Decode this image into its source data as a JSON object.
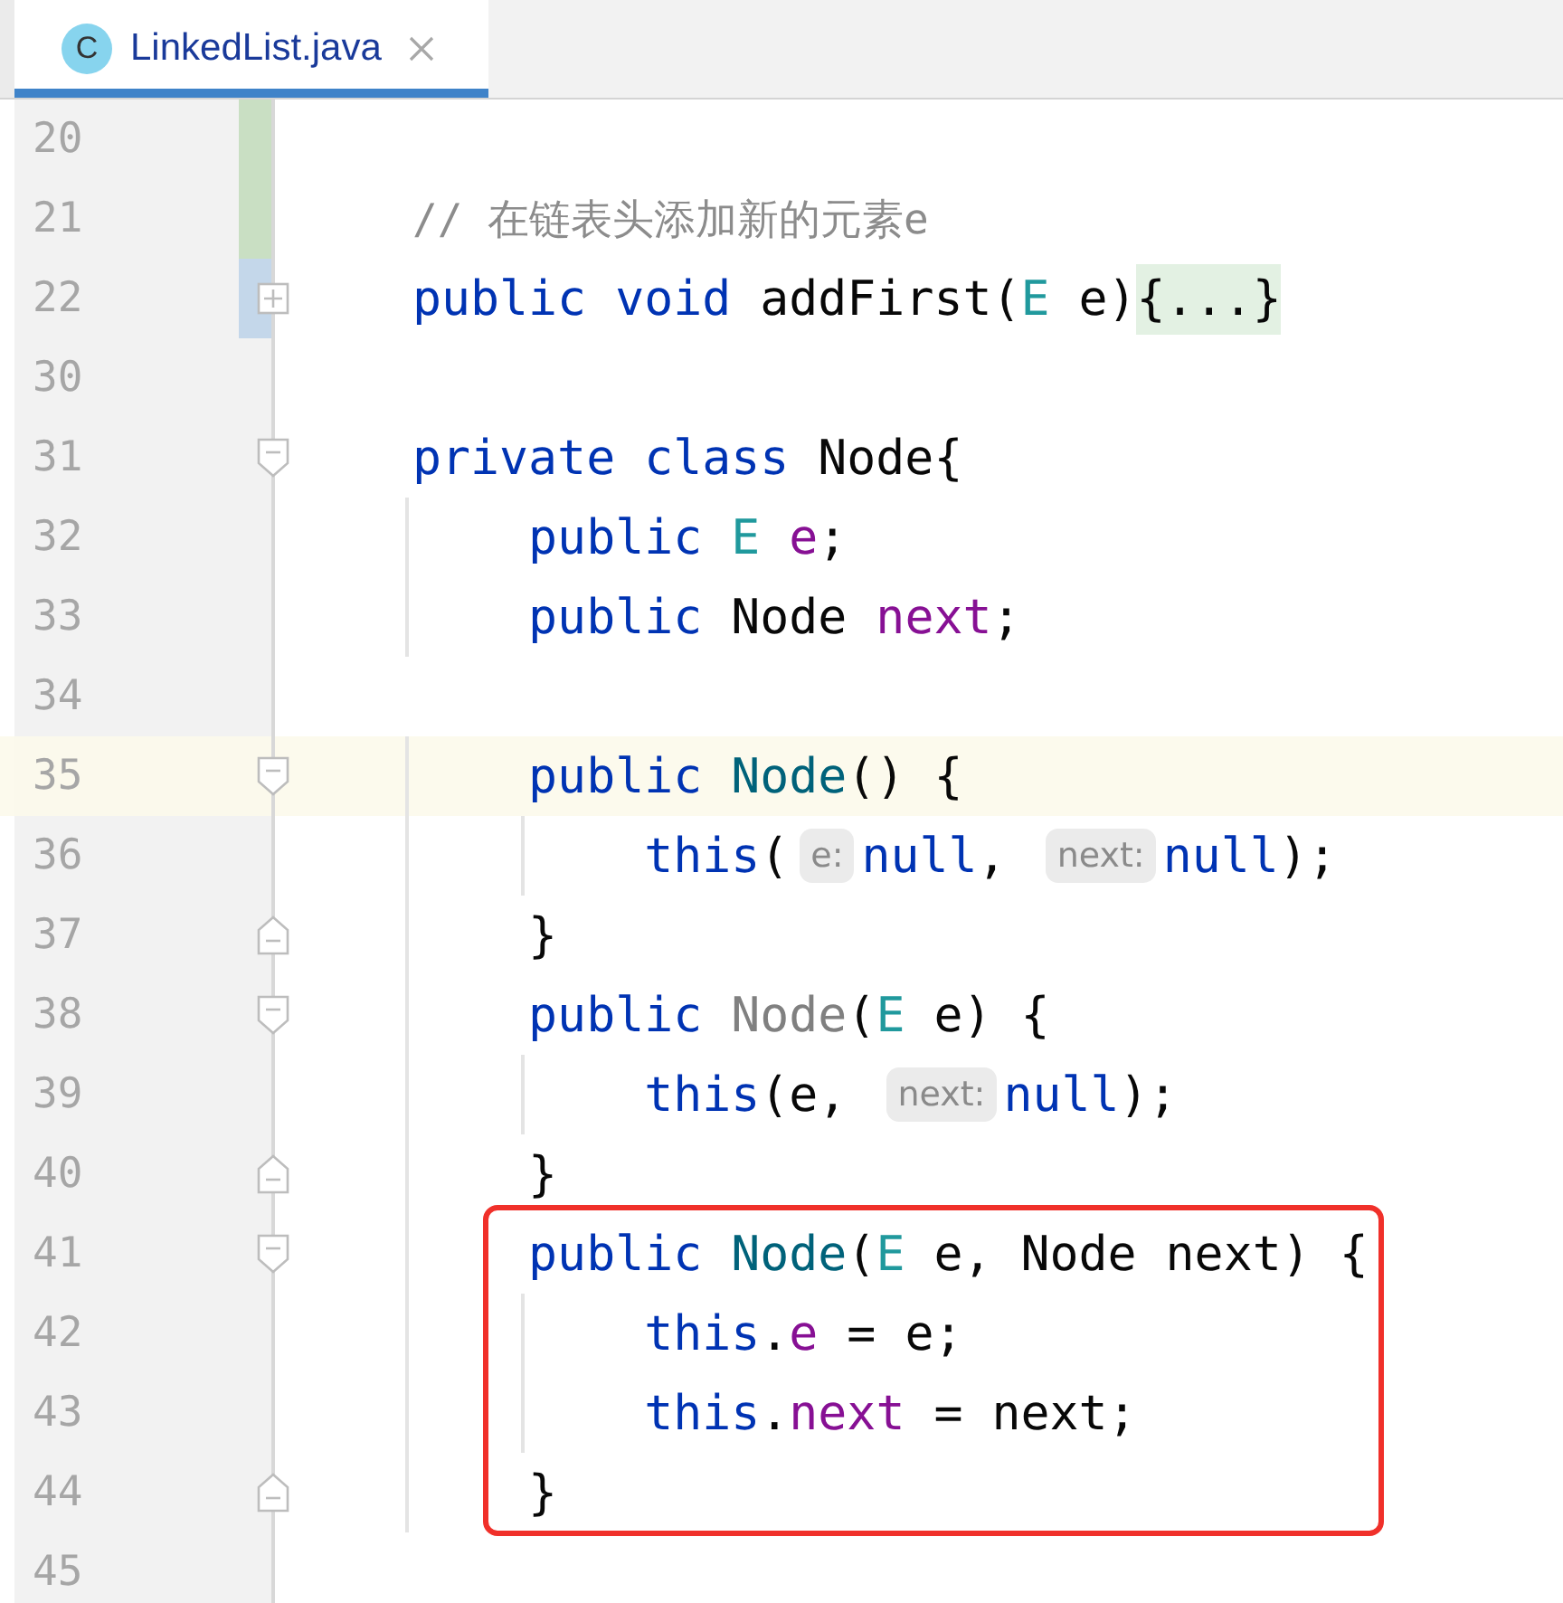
{
  "tabs": [
    {
      "icon_letter": "C",
      "label": "LinkedList.java",
      "selected": true
    }
  ],
  "editor": {
    "blocks": [
      {
        "boxed": false,
        "lines": [
          {
            "number": "20",
            "change_bar": {
              "kind": "added"
            },
            "current": false
          },
          {
            "number": "21",
            "change_bar": {
              "kind": "added"
            },
            "current": false,
            "tokens": [
              {
                "kind": "comment",
                "text": "// 在链表头添加新的元素e"
              }
            ]
          },
          {
            "number": "22",
            "change_bar": {
              "kind": "modified"
            },
            "fold": {
              "kind": "collapsed"
            },
            "current": false,
            "tokens": [
              {
                "kind": "keyword",
                "text": "public void"
              },
              {
                "kind": "plain",
                "text": " addFirst("
              },
              {
                "kind": "type",
                "text": "E"
              },
              {
                "kind": "plain",
                "text": " e)"
              },
              {
                "kind": "folded",
                "text": "{...}"
              }
            ]
          },
          {
            "number": "30",
            "current": false
          },
          {
            "number": "31",
            "fold": {
              "kind": "start"
            },
            "current": false,
            "tokens": [
              {
                "kind": "keyword",
                "text": "private class"
              },
              {
                "kind": "plain",
                "text": " Node{"
              }
            ]
          },
          {
            "number": "32",
            "current": false,
            "tokens": [
              {
                "kind": "keyword",
                "text": "    public"
              },
              {
                "kind": "type",
                "text": " E"
              },
              {
                "kind": "field",
                "text": " e"
              },
              {
                "kind": "plain",
                "text": ";"
              }
            ]
          },
          {
            "number": "33",
            "current": false,
            "tokens": [
              {
                "kind": "keyword",
                "text": "    public"
              },
              {
                "kind": "plain",
                "text": " Node"
              },
              {
                "kind": "field",
                "text": " next"
              },
              {
                "kind": "plain",
                "text": ";"
              }
            ]
          },
          {
            "number": "34",
            "current": false
          },
          {
            "number": "35",
            "fold": {
              "kind": "start"
            },
            "current": true,
            "tokens": [
              {
                "kind": "keyword",
                "text": "    public"
              },
              {
                "kind": "method",
                "text": " Node"
              },
              {
                "kind": "plain",
                "text": "() {"
              }
            ]
          },
          {
            "number": "36",
            "current": false,
            "tokens": [
              {
                "kind": "keyword",
                "text": "        this"
              },
              {
                "kind": "plain",
                "text": "("
              },
              {
                "kind": "hint",
                "text": "e:"
              },
              {
                "kind": "keyword",
                "text": "null"
              },
              {
                "kind": "plain",
                "text": ", "
              },
              {
                "kind": "hint",
                "text": "next:"
              },
              {
                "kind": "keyword",
                "text": "null"
              },
              {
                "kind": "plain",
                "text": ");"
              }
            ]
          },
          {
            "number": "37",
            "fold": {
              "kind": "end"
            },
            "current": false,
            "tokens": [
              {
                "kind": "plain",
                "text": "    }"
              }
            ]
          },
          {
            "number": "38",
            "fold": {
              "kind": "start"
            },
            "current": false,
            "tokens": [
              {
                "kind": "keyword",
                "text": "    public"
              },
              {
                "kind": "unused",
                "text": " Node"
              },
              {
                "kind": "plain",
                "text": "("
              },
              {
                "kind": "type",
                "text": "E"
              },
              {
                "kind": "plain",
                "text": " e) {"
              }
            ]
          },
          {
            "number": "39",
            "current": false,
            "tokens": [
              {
                "kind": "keyword",
                "text": "        this"
              },
              {
                "kind": "plain",
                "text": "(e, "
              },
              {
                "kind": "hint",
                "text": "next:"
              },
              {
                "kind": "keyword",
                "text": "null"
              },
              {
                "kind": "plain",
                "text": ");"
              }
            ]
          },
          {
            "number": "40",
            "fold": {
              "kind": "end"
            },
            "current": false,
            "tokens": [
              {
                "kind": "plain",
                "text": "    }"
              }
            ]
          }
        ]
      },
      {
        "boxed": true,
        "lines": [
          {
            "number": "41",
            "fold": {
              "kind": "start"
            },
            "current": false,
            "tokens": [
              {
                "kind": "keyword",
                "text": "    public"
              },
              {
                "kind": "method",
                "text": " Node"
              },
              {
                "kind": "plain",
                "text": "("
              },
              {
                "kind": "type",
                "text": "E"
              },
              {
                "kind": "plain",
                "text": " e, Node next) {"
              }
            ]
          },
          {
            "number": "42",
            "current": false,
            "tokens": [
              {
                "kind": "keyword",
                "text": "        this"
              },
              {
                "kind": "plain",
                "text": "."
              },
              {
                "kind": "field",
                "text": "e"
              },
              {
                "kind": "plain",
                "text": " = e;"
              }
            ]
          },
          {
            "number": "43",
            "current": false,
            "tokens": [
              {
                "kind": "keyword",
                "text": "        this"
              },
              {
                "kind": "plain",
                "text": "."
              },
              {
                "kind": "field",
                "text": "next"
              },
              {
                "kind": "plain",
                "text": " = next;"
              }
            ]
          },
          {
            "number": "44",
            "fold": {
              "kind": "end"
            },
            "current": false,
            "tokens": [
              {
                "kind": "plain",
                "text": "    }"
              }
            ]
          }
        ]
      },
      {
        "boxed": false,
        "lines": [
          {
            "number": "45",
            "current": false
          }
        ]
      }
    ]
  }
}
